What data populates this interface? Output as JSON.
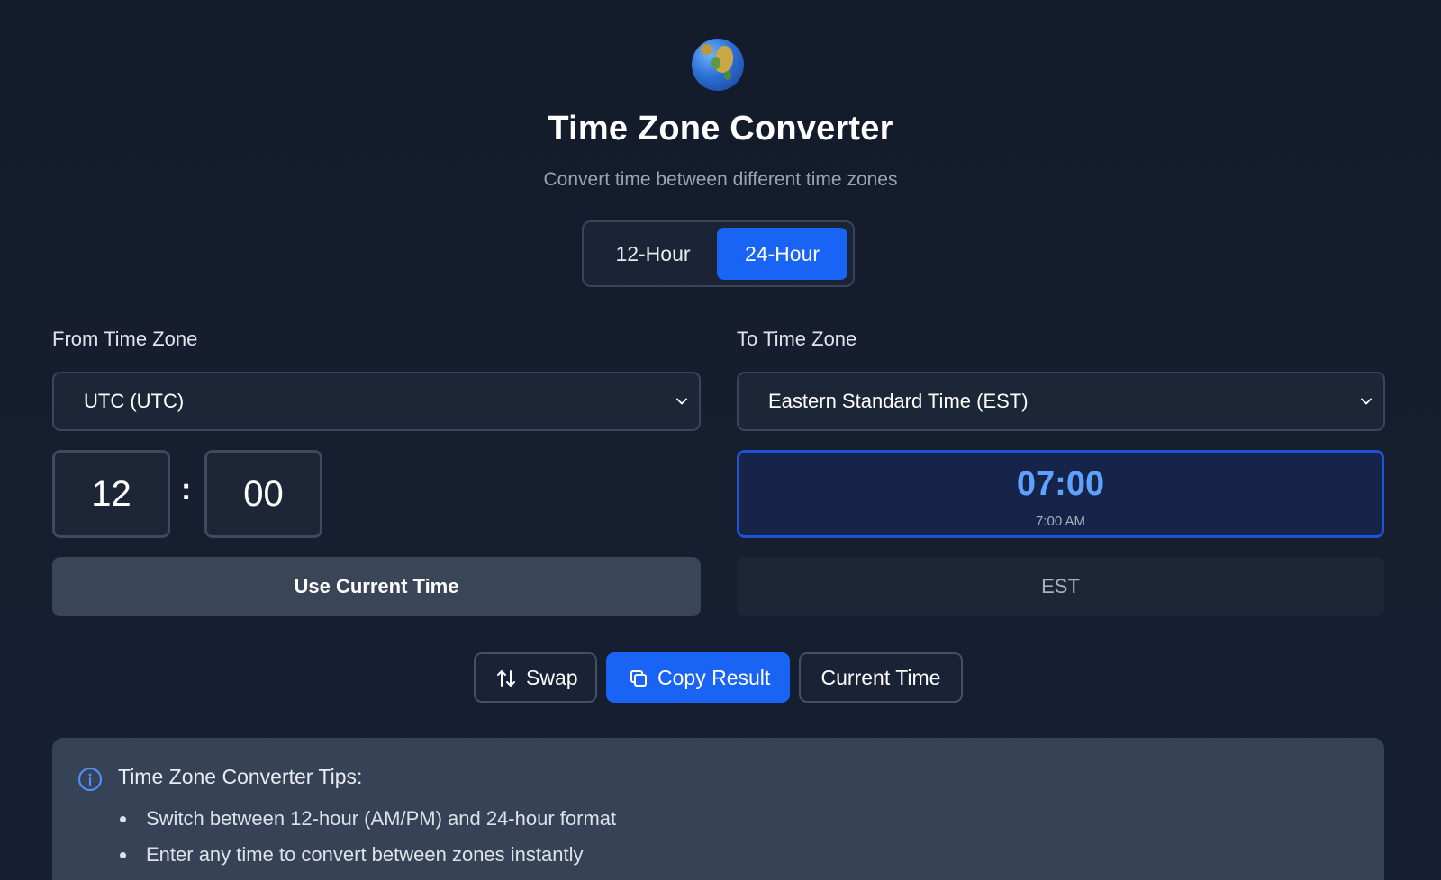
{
  "header": {
    "logo_icon": "globe-icon",
    "title": "Time Zone Converter",
    "subtitle": "Convert time between different time zones"
  },
  "format_toggle": {
    "options": [
      "12-Hour",
      "24-Hour"
    ],
    "selected": "24-Hour"
  },
  "from": {
    "label": "From Time Zone",
    "zone": "UTC (UTC)",
    "hour": "12",
    "separator": ":",
    "minute": "00",
    "use_current_label": "Use Current Time"
  },
  "to": {
    "label": "To Time Zone",
    "zone": "Eastern Standard Time (EST)",
    "result_24": "07:00",
    "result_12": "7:00 AM",
    "abbreviation": "EST"
  },
  "actions": {
    "swap_label": "Swap",
    "copy_label": "Copy Result",
    "current_time_label": "Current Time"
  },
  "tips": {
    "title": "Time Zone Converter Tips:",
    "items": [
      "Switch between 12-hour (AM/PM) and 24-hour format",
      "Enter any time to convert between zones instantly"
    ]
  },
  "colors": {
    "background": "#151d2e",
    "accent": "#1a64f5",
    "result_text": "#5ea1ff",
    "panel": "#364256"
  }
}
